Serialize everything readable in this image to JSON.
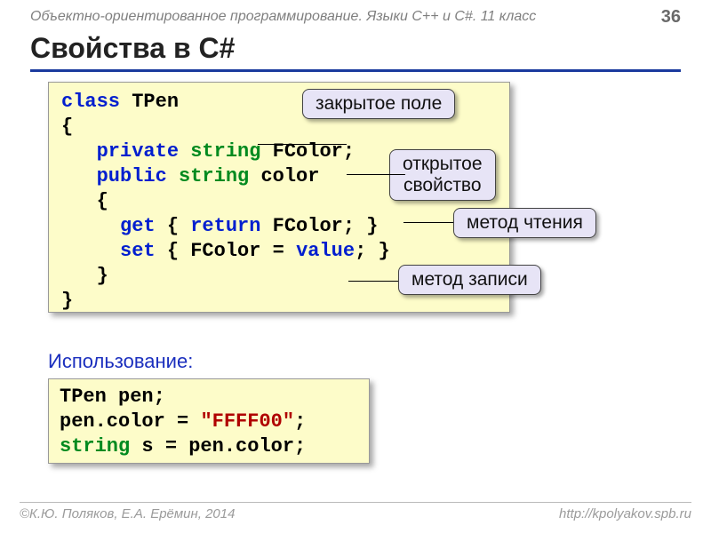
{
  "header": {
    "course": "Объектно-ориентированное программирование. Языки C++ и C#. 11 класс",
    "page_number": "36"
  },
  "title": "Свойства в C#",
  "code1": {
    "l1_class": "class",
    "l1_name": " TPen",
    "l2_brace": "{",
    "l3_priv": "   private ",
    "l3_str": "string",
    "l3_fc": " FColor;",
    "l4_pub": "   public ",
    "l4_str": "string",
    "l4_col": " color",
    "l5_brace": "   {",
    "l6_get": "     get",
    "l6_b1": " { ",
    "l6_ret": "return",
    "l6_rest": " FColor; }",
    "l7_set": "     set",
    "l7_b1": " { FColor = ",
    "l7_val": "value",
    "l7_rest": "; }",
    "l8_brace": "   }",
    "l9_brace": "}"
  },
  "callouts": {
    "c1": "закрытое поле",
    "c2_l1": "открытое",
    "c2_l2": "свойство",
    "c3": "метод чтения",
    "c4": "метод записи"
  },
  "usage_label": "Использование:",
  "code2": {
    "l1": "TPen pen;",
    "l2a": "pen.color = ",
    "l2b": "\"FFFF00\"",
    "l2c": ";",
    "l3a": "string",
    "l3b": " s = pen.color;"
  },
  "footer": {
    "left": "©К.Ю. Поляков, Е.А. Ерёмин, 2014",
    "right": "http://kpolyakov.spb.ru"
  }
}
